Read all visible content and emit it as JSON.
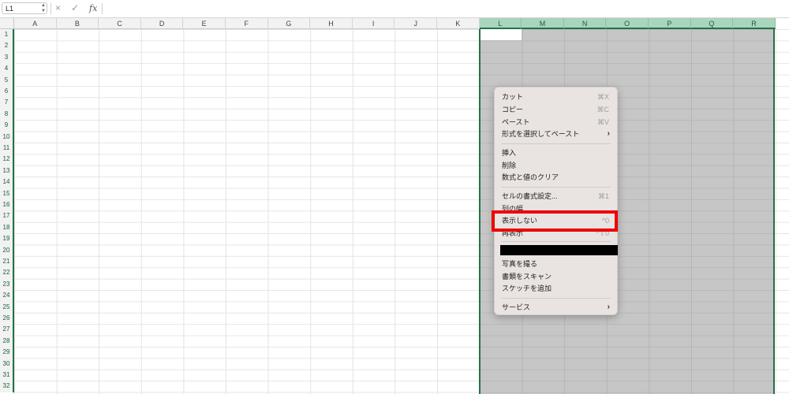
{
  "formula_bar": {
    "name_box": "L1",
    "cancel_icon": "×",
    "enter_icon": "✓",
    "fx_label": "fx",
    "formula": ""
  },
  "columns": [
    "A",
    "B",
    "C",
    "D",
    "E",
    "F",
    "G",
    "H",
    "I",
    "J",
    "K",
    "L",
    "M",
    "N",
    "O",
    "P",
    "Q",
    "R"
  ],
  "selected_columns": [
    "L",
    "M",
    "N",
    "O",
    "P",
    "Q",
    "R"
  ],
  "rows": [
    "1",
    "2",
    "3",
    "4",
    "5",
    "6",
    "7",
    "8",
    "9",
    "10",
    "11",
    "12",
    "13",
    "14",
    "15",
    "16",
    "17",
    "18",
    "19",
    "20",
    "21",
    "22",
    "23",
    "24",
    "25",
    "26",
    "27",
    "28",
    "29",
    "30",
    "31",
    "32"
  ],
  "context_menu": {
    "cut": {
      "label": "カット",
      "shortcut": "⌘X"
    },
    "copy": {
      "label": "コピー",
      "shortcut": "⌘C"
    },
    "paste": {
      "label": "ペースト",
      "shortcut": "⌘V"
    },
    "paste_special": {
      "label": "形式を選択してペースト",
      "arrow": "›"
    },
    "insert": {
      "label": "挿入"
    },
    "delete": {
      "label": "削除"
    },
    "clear_contents": {
      "label": "数式と値のクリア"
    },
    "format_cells": {
      "label": "セルの書式設定...",
      "shortcut": "⌘1"
    },
    "column_width": {
      "label": "列の幅"
    },
    "hide": {
      "label": "表示しない",
      "shortcut": "^0"
    },
    "unhide": {
      "label": "再表示",
      "shortcut": "^⇧0"
    },
    "take_photo": {
      "label": "写真を撮る"
    },
    "scan_documents": {
      "label": "書類をスキャン"
    },
    "add_sketch": {
      "label": "スケッチを追加"
    },
    "services": {
      "label": "サービス",
      "arrow": "›"
    }
  },
  "colors": {
    "accent": "#217346",
    "selection_fill": "#c6c6c6",
    "highlight_border": "#ee0000",
    "menu_bg": "#e9e4e1"
  }
}
